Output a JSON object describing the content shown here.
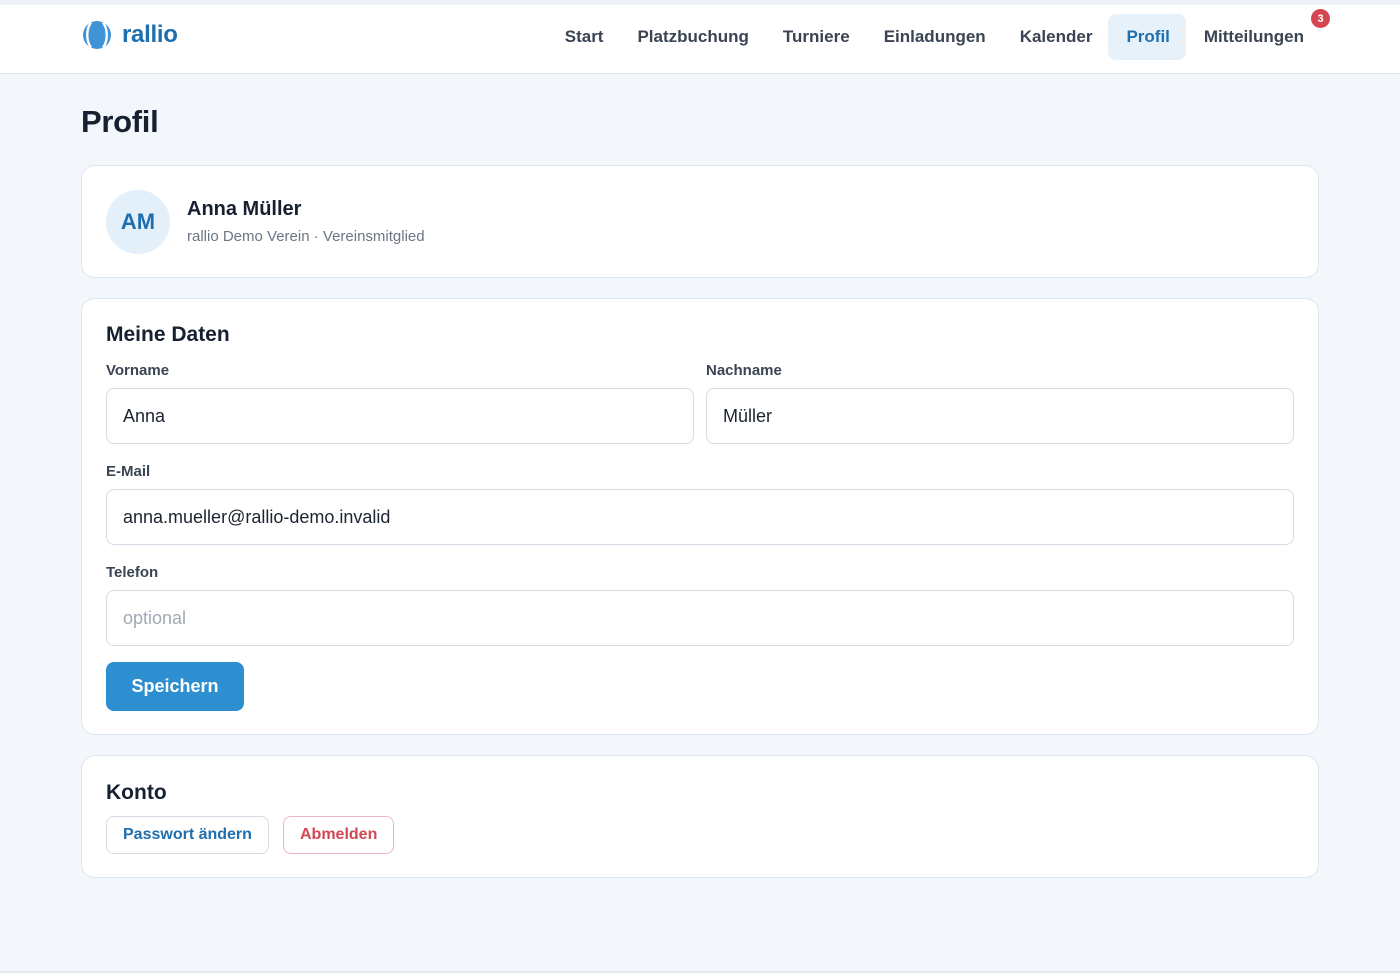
{
  "brand": {
    "name": "rallio",
    "logo_icon": "tennis-ball-icon",
    "color": "#1f6fae"
  },
  "nav": {
    "items": [
      {
        "label": "Start"
      },
      {
        "label": "Platzbuchung"
      },
      {
        "label": "Turniere"
      },
      {
        "label": "Einladungen"
      },
      {
        "label": "Kalender"
      },
      {
        "label": "Profil",
        "active": true
      },
      {
        "label": "Mitteilungen",
        "badge": "3"
      }
    ]
  },
  "page": {
    "title": "Profil"
  },
  "profile": {
    "initials": "AM",
    "name": "Anna Müller",
    "subtitle": "rallio Demo Verein · Vereinsmitglied"
  },
  "form": {
    "title": "Meine Daten",
    "first_name": {
      "label": "Vorname",
      "value": "Anna"
    },
    "last_name": {
      "label": "Nachname",
      "value": "Müller"
    },
    "email": {
      "label": "E-Mail",
      "value": "anna.mueller@rallio-demo.invalid"
    },
    "phone": {
      "label": "Telefon",
      "value": "",
      "placeholder": "optional"
    },
    "save_label": "Speichern"
  },
  "account": {
    "title": "Konto",
    "change_password_label": "Passwort ändern",
    "logout_label": "Abmelden"
  },
  "colors": {
    "accent": "#2e8fd0",
    "danger": "#d14753",
    "badge": "#d64552",
    "background": "#f3f7fb"
  }
}
